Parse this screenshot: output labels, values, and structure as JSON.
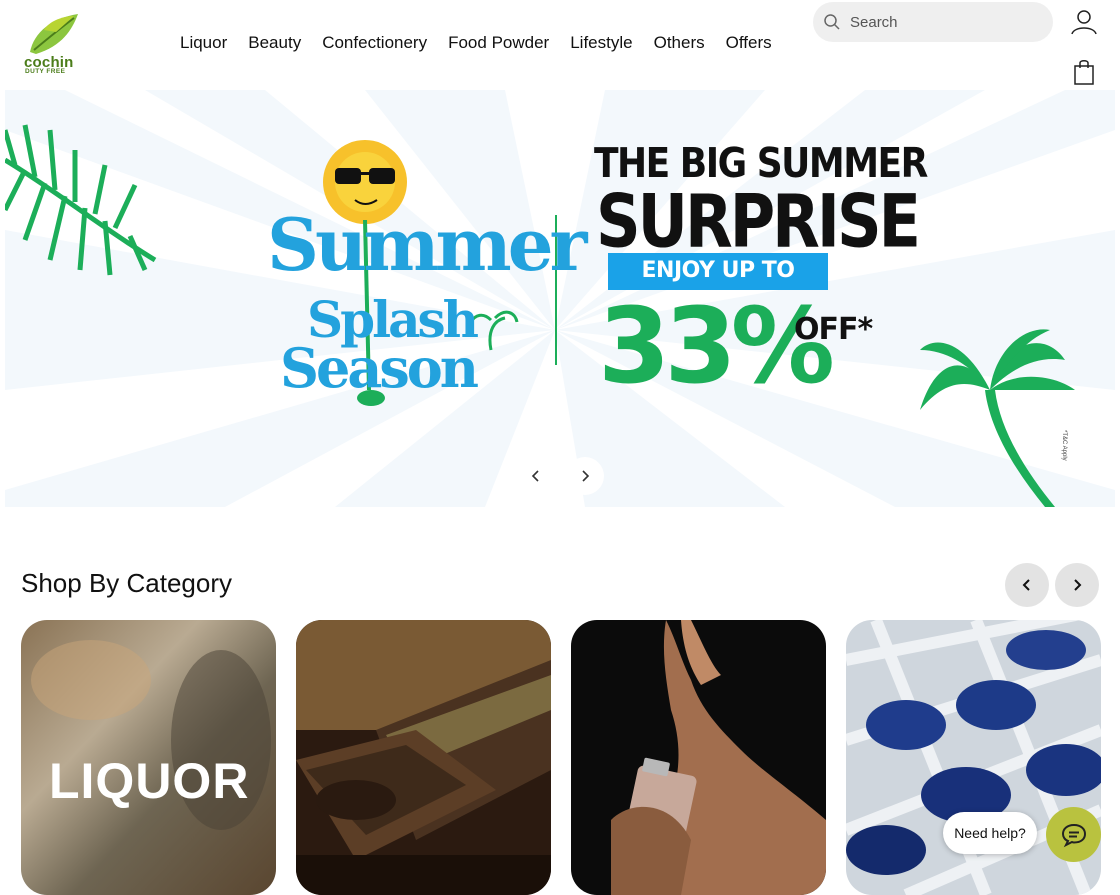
{
  "header": {
    "logo_word": "cochin",
    "logo_sub": "DUTY FREE",
    "nav": [
      "Liquor",
      "Beauty",
      "Confectionery",
      "Food Powder",
      "Lifestyle",
      "Others",
      "Offers"
    ],
    "search_placeholder": "Search"
  },
  "banner": {
    "left_title_1": "Summer",
    "left_title_2": "Splash",
    "left_title_3": "Season",
    "headline_1": "THE BIG SUMMER",
    "headline_2": "SURPRISE",
    "offer_line": "ENJOY UP TO",
    "percent": "33%",
    "off": "OFF*",
    "tc": "*T&C Apply"
  },
  "category": {
    "title": "Shop By Category",
    "cards": [
      {
        "label": "LIQUOR"
      },
      {
        "label": ""
      },
      {
        "label": ""
      },
      {
        "label": ""
      }
    ]
  },
  "chat": {
    "help_label": "Need help?"
  },
  "colors": {
    "brand_green": "#4b7d1a",
    "banner_blue": "#1aa2e8",
    "banner_green": "#1cae59",
    "chat_bg": "#b9c23f"
  }
}
